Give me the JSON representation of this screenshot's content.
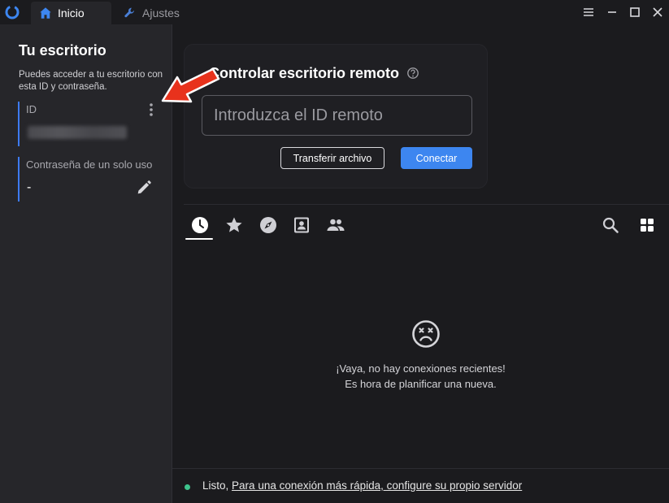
{
  "titlebar": {
    "tabs": [
      {
        "label": "Inicio",
        "icon": "home-icon",
        "active": true
      },
      {
        "label": "Ajustes",
        "icon": "wrench-icon",
        "active": false
      }
    ]
  },
  "left_panel": {
    "title": "Tu escritorio",
    "description": "Puedes acceder a tu escritorio con esta ID y contraseña.",
    "id_label": "ID",
    "password_label": "Contraseña de un solo uso",
    "password_value": "-"
  },
  "connect": {
    "title": "Controlar escritorio remoto",
    "id_placeholder": "Introduzca el ID remoto",
    "transfer_label": "Transferir archivo",
    "connect_label": "Conectar"
  },
  "empty_state": {
    "line1": "¡Vaya, no hay conexiones recientes!",
    "line2": "Es hora de planificar una nueva."
  },
  "status": {
    "state": "Listo,",
    "link": "Para una conexión más rápida, configure su propio servidor"
  },
  "colors": {
    "accent": "#3d86f0",
    "status_ok": "#3ec48d",
    "annotation_arrow": "#e8321c"
  }
}
